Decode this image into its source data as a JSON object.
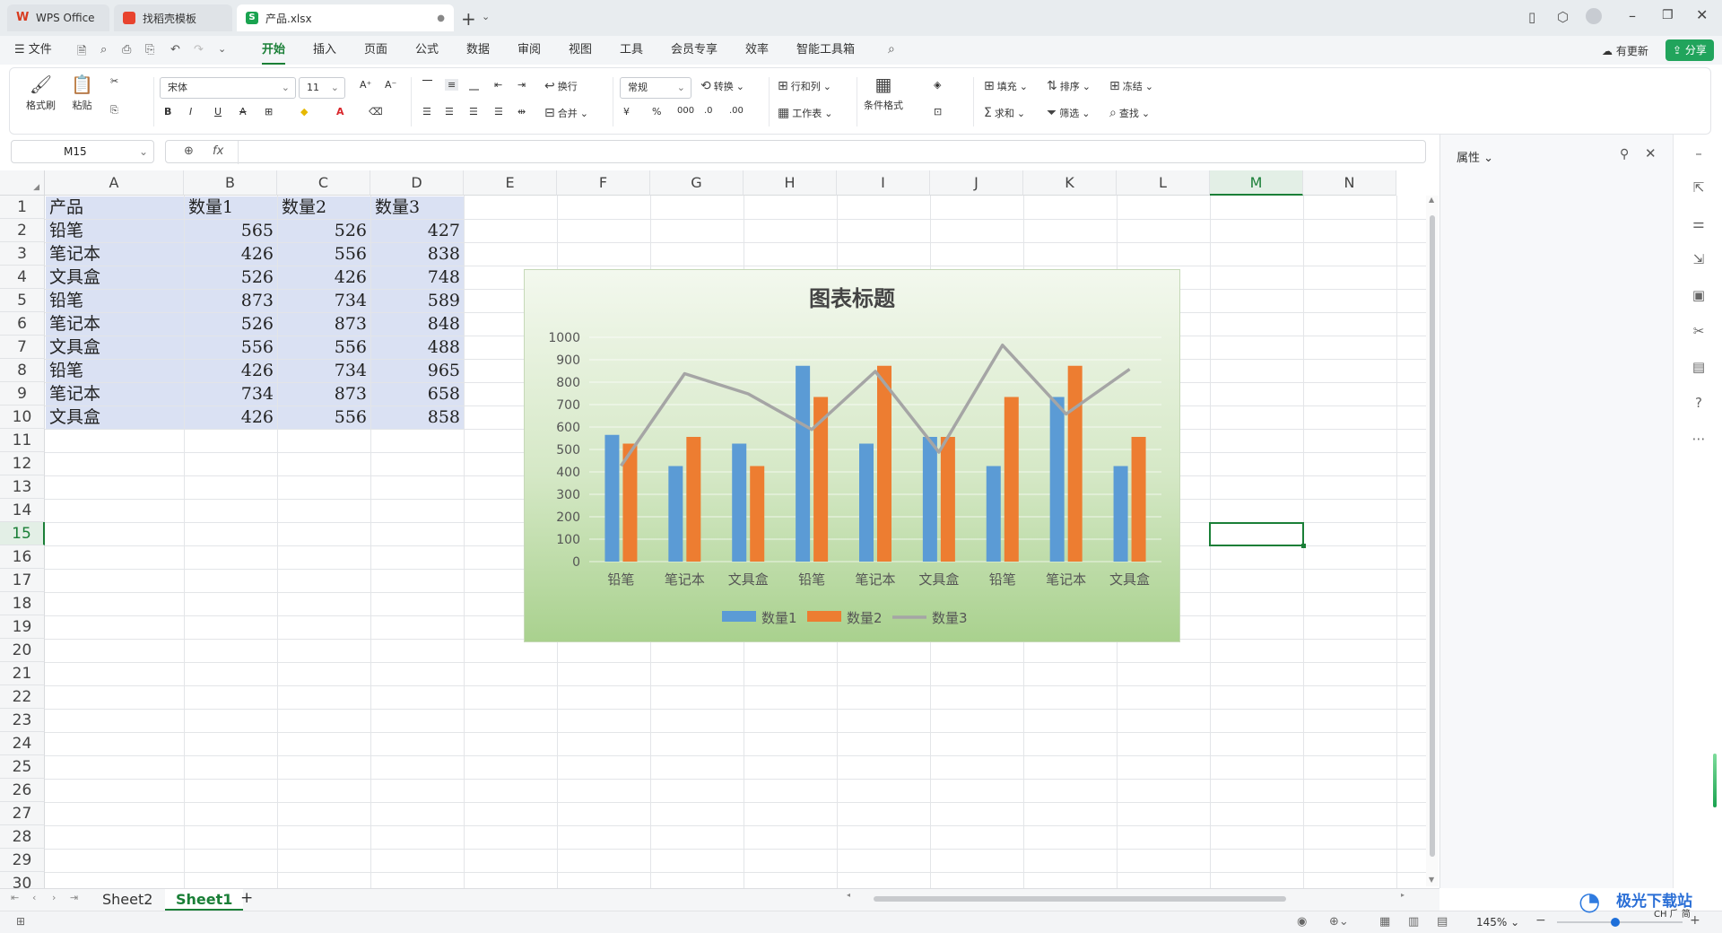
{
  "tabs": [
    {
      "label": "WPS Office"
    },
    {
      "label": "找稻壳模板"
    },
    {
      "label": "产品.xlsx"
    }
  ],
  "menu": {
    "file": "文件",
    "items": [
      "开始",
      "插入",
      "页面",
      "公式",
      "数据",
      "审阅",
      "视图",
      "工具",
      "会员专享",
      "效率",
      "智能工具箱"
    ],
    "active": "开始",
    "update": "有更新",
    "share": "分享"
  },
  "ribbon": {
    "format_painter": "格式刷",
    "paste": "粘贴",
    "font_name": "宋体",
    "font_size": "11",
    "wrap": "换行",
    "merge": "合并",
    "number_format": "常规",
    "convert": "转换",
    "row_col": "行和列",
    "worksheet": "工作表",
    "cond_format": "条件格式",
    "fill": "填充",
    "sort": "排序",
    "freeze": "冻结",
    "sum": "求和",
    "filter": "筛选",
    "find": "查找"
  },
  "formula_bar": {
    "name_box": "M15",
    "fx": "fx",
    "value": ""
  },
  "columns": [
    "A",
    "B",
    "C",
    "D",
    "E",
    "F",
    "G",
    "H",
    "I",
    "J",
    "K",
    "L",
    "M",
    "N"
  ],
  "selected_column": "M",
  "selected_row": "15",
  "rows": [
    "1",
    "2",
    "3",
    "4",
    "5",
    "6",
    "7",
    "8",
    "9",
    "10",
    "11",
    "12",
    "13",
    "14",
    "15",
    "16",
    "17",
    "18",
    "19",
    "20",
    "21",
    "22",
    "23",
    "24",
    "25",
    "26",
    "27",
    "28",
    "29",
    "30"
  ],
  "table": {
    "header": [
      "产品",
      "数量1",
      "数量2",
      "数量3"
    ],
    "rows": [
      [
        "铅笔",
        "565",
        "526",
        "427"
      ],
      [
        "笔记本",
        "426",
        "556",
        "838"
      ],
      [
        "文具盒",
        "526",
        "426",
        "748"
      ],
      [
        "铅笔",
        "873",
        "734",
        "589"
      ],
      [
        "笔记本",
        "526",
        "873",
        "848"
      ],
      [
        "文具盒",
        "556",
        "556",
        "488"
      ],
      [
        "铅笔",
        "426",
        "734",
        "965"
      ],
      [
        "笔记本",
        "734",
        "873",
        "658"
      ],
      [
        "文具盒",
        "426",
        "556",
        "858"
      ]
    ]
  },
  "chart_data": {
    "type": "bar",
    "title": "图表标题",
    "categories": [
      "铅笔",
      "笔记本",
      "文具盒",
      "铅笔",
      "笔记本",
      "文具盒",
      "铅笔",
      "笔记本",
      "文具盒"
    ],
    "series": [
      {
        "name": "数量1",
        "kind": "bar",
        "color": "#5b9bd5",
        "values": [
          565,
          426,
          526,
          873,
          526,
          556,
          426,
          734,
          426
        ]
      },
      {
        "name": "数量2",
        "kind": "bar",
        "color": "#ed7d31",
        "values": [
          526,
          556,
          426,
          734,
          873,
          556,
          734,
          873,
          556
        ]
      },
      {
        "name": "数量3",
        "kind": "line",
        "color": "#a5a5a5",
        "values": [
          427,
          838,
          748,
          589,
          848,
          488,
          965,
          658,
          858
        ]
      }
    ],
    "yticks": [
      "0",
      "100",
      "200",
      "300",
      "400",
      "500",
      "600",
      "700",
      "800",
      "900",
      "1000"
    ],
    "ylim": [
      0,
      1000
    ],
    "legend_position": "bottom"
  },
  "sidebar": {
    "title": "属性"
  },
  "sheets": {
    "tabs": [
      "Sheet2",
      "Sheet1"
    ],
    "active": "Sheet1",
    "add": "+"
  },
  "status": {
    "zoom": "145%"
  },
  "watermark": {
    "text": "极光下载站",
    "ime": "CH ⺁ 简"
  }
}
